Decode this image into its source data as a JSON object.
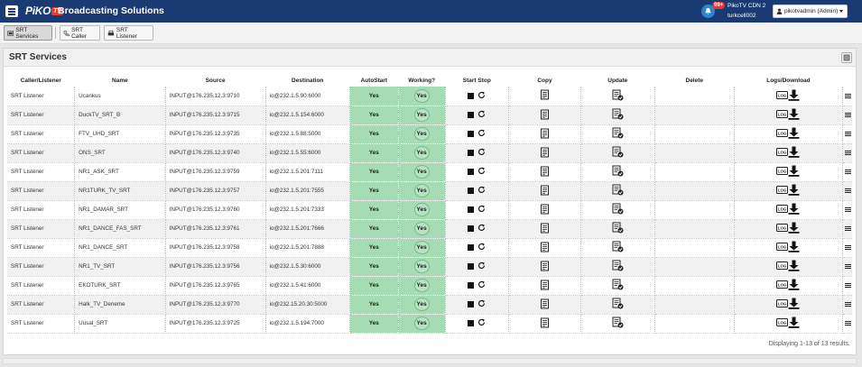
{
  "header": {
    "logo_text": "PiKO",
    "logo_badge": "TV",
    "title": "Broadcasting Solutions",
    "notification_count": "99+",
    "cdn_name": "PikoTV CDN 2",
    "cdn_user": "turkcell002",
    "user_label": "pikotvadmin (Admin)",
    "brand_color": "#1a3a73"
  },
  "toolbar": {
    "srt_services": "SRT Services",
    "srt_caller": "SRT Caller",
    "srt_listener": "SRT Listener"
  },
  "panel": {
    "title": "SRT Services"
  },
  "table": {
    "headers": {
      "caller_listener": "Caller/Listener",
      "name": "Name",
      "source": "Source",
      "destination": "Destination",
      "autostart": "AutoStart",
      "working": "Working?",
      "start_stop": "Start Stop",
      "copy": "Copy",
      "update": "Update",
      "delete": "Delete",
      "logs_download": "Logs/Download"
    },
    "rows": [
      {
        "mode": "SRT Listener",
        "name": "Ucankus",
        "source": "INPUT@176.235.12.3:9710",
        "destination": "io@232.1.5.90:6000",
        "autostart": "Yes",
        "working": "Yes"
      },
      {
        "mode": "SRT Listener",
        "name": "DuckTV_SRT_B",
        "source": "INPUT@176.235.12.3:9715",
        "destination": "io@232.1.5.154:6000",
        "autostart": "Yes",
        "working": "Yes"
      },
      {
        "mode": "SRT Listener",
        "name": "FTV_UHD_SRT",
        "source": "INPUT@176.235.12.3:9735",
        "destination": "io@232.1.5.88:5000",
        "autostart": "Yes",
        "working": "Yes"
      },
      {
        "mode": "SRT Listener",
        "name": "ONS_SRT",
        "source": "INPUT@176.235.12.3:9740",
        "destination": "io@232.1.5.55:6000",
        "autostart": "Yes",
        "working": "Yes"
      },
      {
        "mode": "SRT Listener",
        "name": "NR1_ASK_SRT",
        "source": "INPUT@176.235.12.3:9759",
        "destination": "io@232.1.5.201:7111",
        "autostart": "Yes",
        "working": "Yes"
      },
      {
        "mode": "SRT Listener",
        "name": "NR1TURK_TV_SRT",
        "source": "INPUT@176.235.12.3:9757",
        "destination": "io@232.1.5.201:7555",
        "autostart": "Yes",
        "working": "Yes"
      },
      {
        "mode": "SRT Listener",
        "name": "NR1_DAMAR_SRT",
        "source": "INPUT@176.235.12.3:9760",
        "destination": "io@232.1.5.201:7333",
        "autostart": "Yes",
        "working": "Yes"
      },
      {
        "mode": "SRT Listener",
        "name": "NR1_DANCE_FAS_SRT",
        "source": "INPUT@176.235.12.3:9761",
        "destination": "io@232.1.5.201:7666",
        "autostart": "Yes",
        "working": "Yes"
      },
      {
        "mode": "SRT Listener",
        "name": "NR1_DANCE_SRT",
        "source": "INPUT@176.235.12.3:9758",
        "destination": "io@232.1.5.201:7888",
        "autostart": "Yes",
        "working": "Yes"
      },
      {
        "mode": "SRT Listener",
        "name": "NR1_TV_SRT",
        "source": "INPUT@176.235.12.3:9756",
        "destination": "io@232.1.5.30:6000",
        "autostart": "Yes",
        "working": "Yes"
      },
      {
        "mode": "SRT Listener",
        "name": "EKOTURK_SRT",
        "source": "INPUT@176.235.12.3:9765",
        "destination": "io@232.1.5.41:6000",
        "autostart": "Yes",
        "working": "Yes"
      },
      {
        "mode": "SRT Listener",
        "name": "Halk_TV_Deneme",
        "source": "INPUT@176.235.12.3:9770",
        "destination": "io@232.15.20.30:5000",
        "autostart": "Yes",
        "working": "Yes"
      },
      {
        "mode": "SRT Listener",
        "name": "Uusal_SRT",
        "source": "INPUT@176.235.12.3:9725",
        "destination": "io@232.1.5.194:7000",
        "autostart": "Yes",
        "working": "Yes"
      }
    ]
  },
  "footer": {
    "display_info": "Displaying 1-13 of 13 results."
  },
  "colors": {
    "status_green": "#a6dcb3",
    "notification_red": "#e33333"
  }
}
